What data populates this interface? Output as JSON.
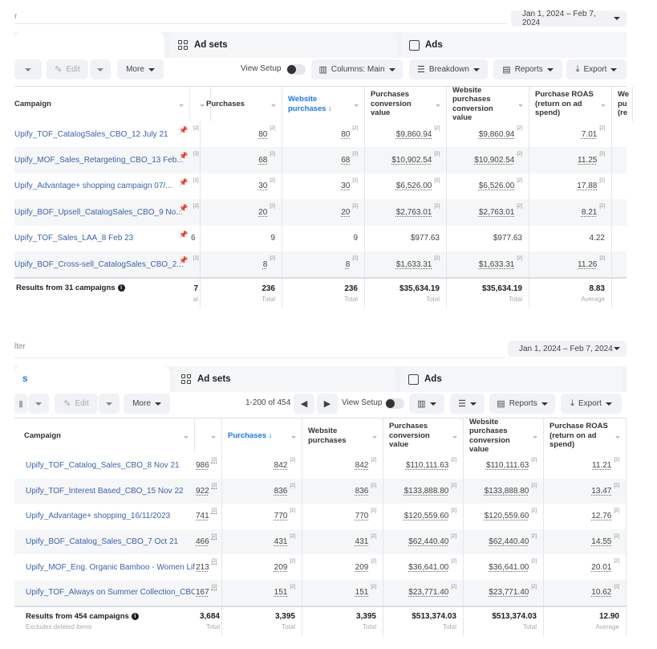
{
  "colors": {
    "link": "#3b62b3",
    "accent": "#1877f2",
    "row_alt": "#f5f6f7"
  },
  "panels": [
    {
      "filter_text": "r",
      "date_range": "Jan 1, 2024 – Feb 7, 2024",
      "tabs": [
        {
          "label": "",
          "icon": "campaigns-icon",
          "active": true
        },
        {
          "label": "Ad sets",
          "icon": "ad-sets-icon"
        },
        {
          "label": "Ads",
          "icon": "ads-icon"
        }
      ],
      "toolbar": {
        "edit": "Edit",
        "more": "More",
        "pagination": "",
        "view_setup": "View Setup",
        "columns": "Columns: Main",
        "breakdown": "Breakdown",
        "reports": "Reports",
        "export": "Export"
      },
      "headers": [
        "Campaign",
        "",
        "Purchases",
        "Website purchases ↓",
        "Purchases conversion value",
        "Website purchases conversion value",
        "Purchase ROAS (return on ad spend)",
        "We pu (re"
      ],
      "sorted_col": 3,
      "rows": [
        {
          "name": "Upify_TOF_CatalogSales_CBO_12 July 21",
          "pinned": true,
          "partial": "",
          "values": [
            "80",
            "80",
            "$9,860.94",
            "$9,860.94",
            "7.01"
          ],
          "footnote": true
        },
        {
          "name": "Upify_MOF_Sales_Retargeting_CBO_13 Feb...",
          "pinned": true,
          "partial": "",
          "values": [
            "68",
            "68",
            "$10,902.54",
            "$10,902.54",
            "11.25"
          ],
          "footnote": true
        },
        {
          "name": "Upify_Advantage+ shopping campaign 07/...",
          "pinned": true,
          "partial": "",
          "values": [
            "30",
            "30",
            "$6,526.00",
            "$6,526.00",
            "17.88"
          ],
          "footnote": true
        },
        {
          "name": "Upify_BOF_Upsell_CatalogSales_CBO_9 No...",
          "pinned": true,
          "partial": "",
          "values": [
            "20",
            "20",
            "$2,763.01",
            "$2,763.01",
            "8.21"
          ],
          "footnote": true
        },
        {
          "name": "Upify_TOF_Sales_LAA_8 Feb 23",
          "pinned": true,
          "partial": "6",
          "values": [
            "9",
            "9",
            "$977.63",
            "$977.63",
            "4.22"
          ],
          "footnote": false
        },
        {
          "name": "Upify_BOF_Cross-sell_CatalogSales_CBO_2...",
          "pinned": true,
          "partial": "",
          "values": [
            "8",
            "8",
            "$1,633.31",
            "$1,633.31",
            "11.26"
          ],
          "footnote": true
        }
      ],
      "summary": {
        "label": "Results from 31 campaigns",
        "sub": "",
        "partial": "7",
        "partial_sub": "al",
        "values": [
          "236",
          "236",
          "$35,634.19",
          "$35,634.19",
          "8.83"
        ],
        "subs": [
          "Total",
          "Total",
          "Total",
          "Total",
          "Average"
        ]
      }
    },
    {
      "filter_text": "lter",
      "date_range": "Jan 1, 2024 – Feb 7, 2024",
      "tabs": [
        {
          "label": "s",
          "icon": "campaigns-icon",
          "active": true
        },
        {
          "label": "Ad sets",
          "icon": "ad-sets-icon"
        },
        {
          "label": "Ads",
          "icon": "ads-icon"
        }
      ],
      "toolbar": {
        "edit": "Edit",
        "more": "More",
        "pagination": "1-200 of 454",
        "view_setup": "View Setup",
        "columns": "",
        "breakdown": "",
        "reports": "Reports",
        "export": "Export"
      },
      "headers": [
        "Campaign",
        "",
        "Purchases ↓",
        "Website purchases",
        "Purchases conversion value",
        "Website purchases conversion value",
        "Purchase ROAS (return on ad spend)"
      ],
      "sorted_col": 2,
      "rows": [
        {
          "name": "Upify_TOF_Catalog_Sales_CBO_8 Nov 21",
          "pinned": false,
          "partial": "986",
          "values": [
            "842",
            "842",
            "$110,111.63",
            "$110,111.63",
            "11.21"
          ],
          "footnote": true
        },
        {
          "name": "Upify_TOF_Interest Based_CBO_15 Nov 22",
          "pinned": false,
          "partial": "922",
          "values": [
            "836",
            "836",
            "$133,888.80",
            "$133,888.80",
            "13.47"
          ],
          "footnote": true
        },
        {
          "name": "Upify_Advantage+ shopping_16/11/2023",
          "pinned": false,
          "partial": "741",
          "values": [
            "770",
            "770",
            "$120,559.60",
            "$120,559.60",
            "12.76"
          ],
          "footnote": true
        },
        {
          "name": "Upify_BOF_Catalog_Sales_CBO_7 Oct 21",
          "pinned": false,
          "partial": "466",
          "values": [
            "431",
            "431",
            "$62,440.40",
            "$62,440.40",
            "14.55"
          ],
          "footnote": true
        },
        {
          "name": "Upify_MOF_Eng. Organic Bamboo - Women Lif...",
          "pinned": false,
          "partial": "213",
          "values": [
            "209",
            "209",
            "$36,641.00",
            "$36,641.00",
            "20.01"
          ],
          "footnote": true
        },
        {
          "name": "Upify_TOF_Always on Summer Collection_CBO...",
          "pinned": false,
          "partial": "167",
          "values": [
            "151",
            "151",
            "$23,771.40",
            "$23,771.40",
            "10.62"
          ],
          "footnote": true
        }
      ],
      "summary": {
        "label": "Results from 454 campaigns",
        "sub": "Excludes deleted items",
        "partial": "3,684",
        "partial_sub": "Total",
        "values": [
          "3,395",
          "3,395",
          "$513,374.03",
          "$513,374.03",
          "12.90"
        ],
        "subs": [
          "Total",
          "Total",
          "Total",
          "Total",
          "Average"
        ]
      }
    }
  ]
}
